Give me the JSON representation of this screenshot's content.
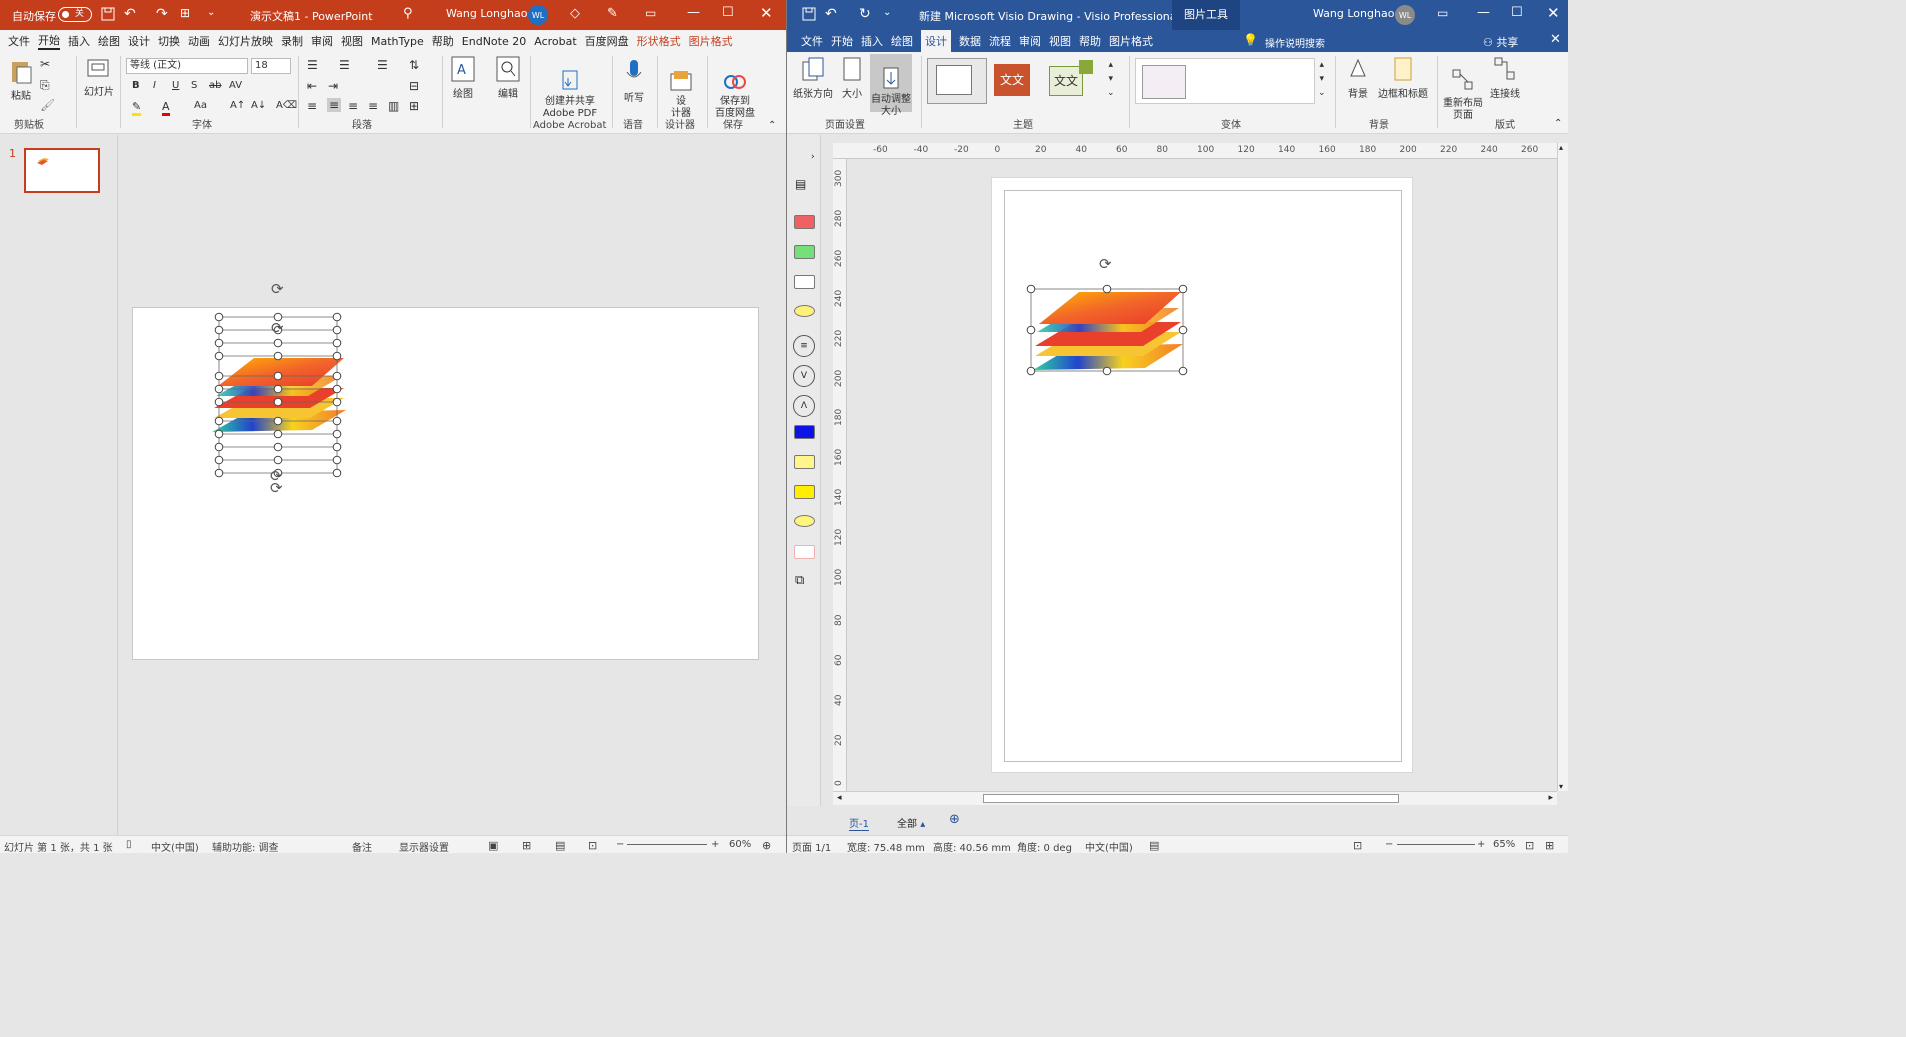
{
  "ppt": {
    "title": {
      "autosave": "自动保存",
      "toggle": "关",
      "doc": "演示文稿1 - PowerPoint",
      "user": "Wang Longhao",
      "initials": "WL"
    },
    "menu": [
      "文件",
      "开始",
      "插入",
      "绘图",
      "设计",
      "切换",
      "动画",
      "幻灯片放映",
      "录制",
      "审阅",
      "视图",
      "MathType",
      "帮助",
      "EndNote 20",
      "Acrobat",
      "百度网盘",
      "形状格式",
      "图片格式"
    ],
    "ribbon": {
      "paste": "粘贴",
      "slides": "幻灯片",
      "font_name": "等线 (正文)",
      "font_size": "18",
      "draw": "绘图",
      "edit": "编辑",
      "create_pdf": "创建并共享\nAdobe PDF",
      "dictate": "听写",
      "designer": "设\n计器",
      "save_baidu": "保存到\n百度网盘",
      "groups": [
        "剪贴板",
        "字体",
        "段落",
        "Adobe Acrobat",
        "语音",
        "设计器",
        "保存"
      ]
    },
    "thumb_index": "1",
    "status": {
      "slide": "幻灯片 第 1 张，共 1 张",
      "lang": "中文(中国)",
      "access": "辅助功能: 调查",
      "notes": "备注",
      "display": "显示器设置",
      "zoom": "60%"
    }
  },
  "visio": {
    "title": {
      "doc": "新建 Microsoft Visio Drawing  -  Visio Professional",
      "tools": "图片工具",
      "user": "Wang Longhao",
      "initials": "WL"
    },
    "menu": [
      "文件",
      "开始",
      "插入",
      "绘图",
      "设计",
      "数据",
      "流程",
      "审阅",
      "视图",
      "帮助",
      "图片格式"
    ],
    "search": "操作说明搜索",
    "share": "共享",
    "ribbon": {
      "orient": "纸张方向",
      "size": "大小",
      "autofit": "自动调整\n大小",
      "bg": "背景",
      "border": "边框和标题",
      "relayout": "重新布局\n页面",
      "connector": "连接线",
      "theme_text": "文文",
      "groups": [
        "页面设置",
        "主题",
        "变体",
        "背景",
        "版式"
      ]
    },
    "ruler_h": [
      "-60",
      "-40",
      "-20",
      "0",
      "20",
      "40",
      "60",
      "80",
      "100",
      "120",
      "140",
      "160",
      "180",
      "200",
      "220",
      "240",
      "260"
    ],
    "ruler_v": [
      "300",
      "280",
      "260",
      "240",
      "220",
      "200",
      "180",
      "160",
      "140",
      "120",
      "100",
      "80",
      "60",
      "40",
      "20",
      "0"
    ],
    "stencil_circles": [
      "≡",
      "V",
      "Λ"
    ],
    "page_tab": "页-1",
    "all": "全部",
    "status": {
      "page": "页面 1/1",
      "width": "宽度: 75.48 mm",
      "height": "高度: 40.56 mm",
      "angle": "角度: 0 deg",
      "lang": "中文(中国)",
      "zoom": "65%"
    }
  }
}
